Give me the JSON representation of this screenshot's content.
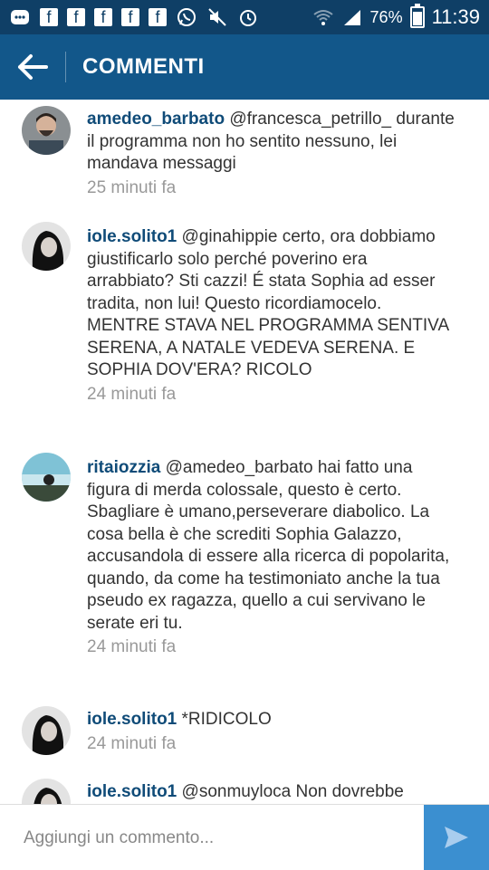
{
  "statusbar": {
    "battery": "76%",
    "time": "11:39"
  },
  "header": {
    "title": "COMMENTI"
  },
  "comments": [
    {
      "user": "amedeo_barbato",
      "text": "@francesca_petrillo_ durante il programma non ho sentito nessuno, lei mandava messaggi",
      "time": "25 minuti fa"
    },
    {
      "user": "iole.solito1",
      "text": "@ginahippie certo, ora dobbiamo giustificarlo solo perché poverino era arrabbiato? Sti cazzi! É stata Sophia ad esser tradita, non lui! Questo ricordiamocelo. MENTRE STAVA NEL PROGRAMMA SENTIVA SERENA, A NATALE VEDEVA SERENA. E SOPHIA DOV'ERA? RICOLO",
      "time": "24 minuti fa"
    },
    {
      "user": "ritaiozzia",
      "text": "@amedeo_barbato hai fatto una figura di merda colossale, questo è certo. Sbagliare è umano,perseverare diabolico. La cosa bella è che screditi Sophia Galazzo, accusandola di essere alla ricerca di popolarita, quando, da come ha testimoniato anche la tua pseudo ex ragazza, quello a cui servivano le serate eri tu.",
      "time": "24 minuti fa"
    },
    {
      "user": "iole.solito1",
      "text": "*RIDICOLO",
      "time": "24 minuti fa"
    },
    {
      "user": "iole.solito1",
      "text": "@sonmuyloca Non dovrebbe",
      "time": ""
    }
  ],
  "composer": {
    "placeholder": "Aggiungi un commento..."
  }
}
